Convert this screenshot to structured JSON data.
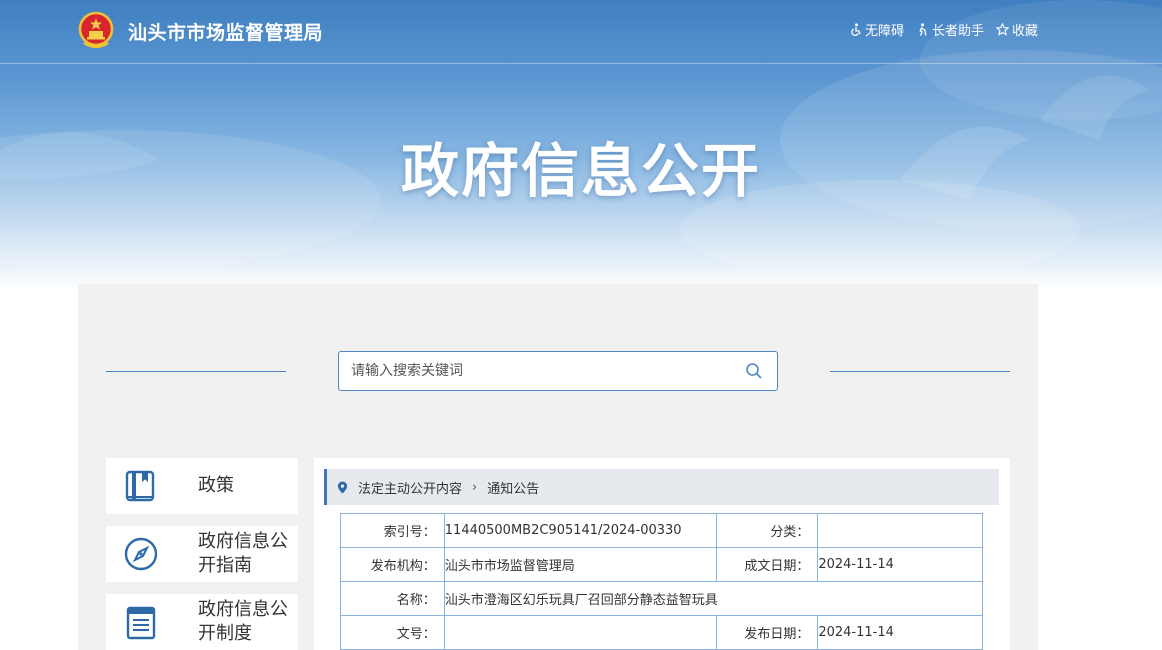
{
  "header": {
    "site_title": "汕头市市场监督管理局",
    "links": [
      {
        "icon": "accessibility-icon",
        "label": "无障碍"
      },
      {
        "icon": "elder-assist-icon",
        "label": "长者助手"
      },
      {
        "icon": "star-icon",
        "label": "收藏"
      }
    ]
  },
  "hero": {
    "title": "政府信息公开"
  },
  "search": {
    "placeholder": "请输入搜索关键词"
  },
  "sidebar": {
    "items": [
      {
        "icon": "book-icon",
        "label": "政策"
      },
      {
        "icon": "compass-icon",
        "label": "政府信息公开指南"
      },
      {
        "icon": "document-list-icon",
        "label": "政府信息公开制度"
      }
    ]
  },
  "breadcrumb": {
    "items": [
      "法定主动公开内容",
      "通知公告"
    ]
  },
  "meta": {
    "index_no_label": "索引号：",
    "index_no": "11440500MB2C905141/2024-00330",
    "category_label": "分类：",
    "category": "",
    "publisher_label": "发布机构：",
    "publisher": "汕头市市场监督管理局",
    "created_label": "成文日期：",
    "created": "2024-11-14",
    "name_label": "名称：",
    "name": "汕头市澄海区幻乐玩具厂召回部分静态益智玩具",
    "doc_no_label": "文号：",
    "doc_no": "",
    "published_label": "发布日期：",
    "published": "2024-11-14"
  },
  "colors": {
    "accent": "#3d78b8",
    "border": "#8cb3dc",
    "panel_bg": "#f1f1f1"
  }
}
